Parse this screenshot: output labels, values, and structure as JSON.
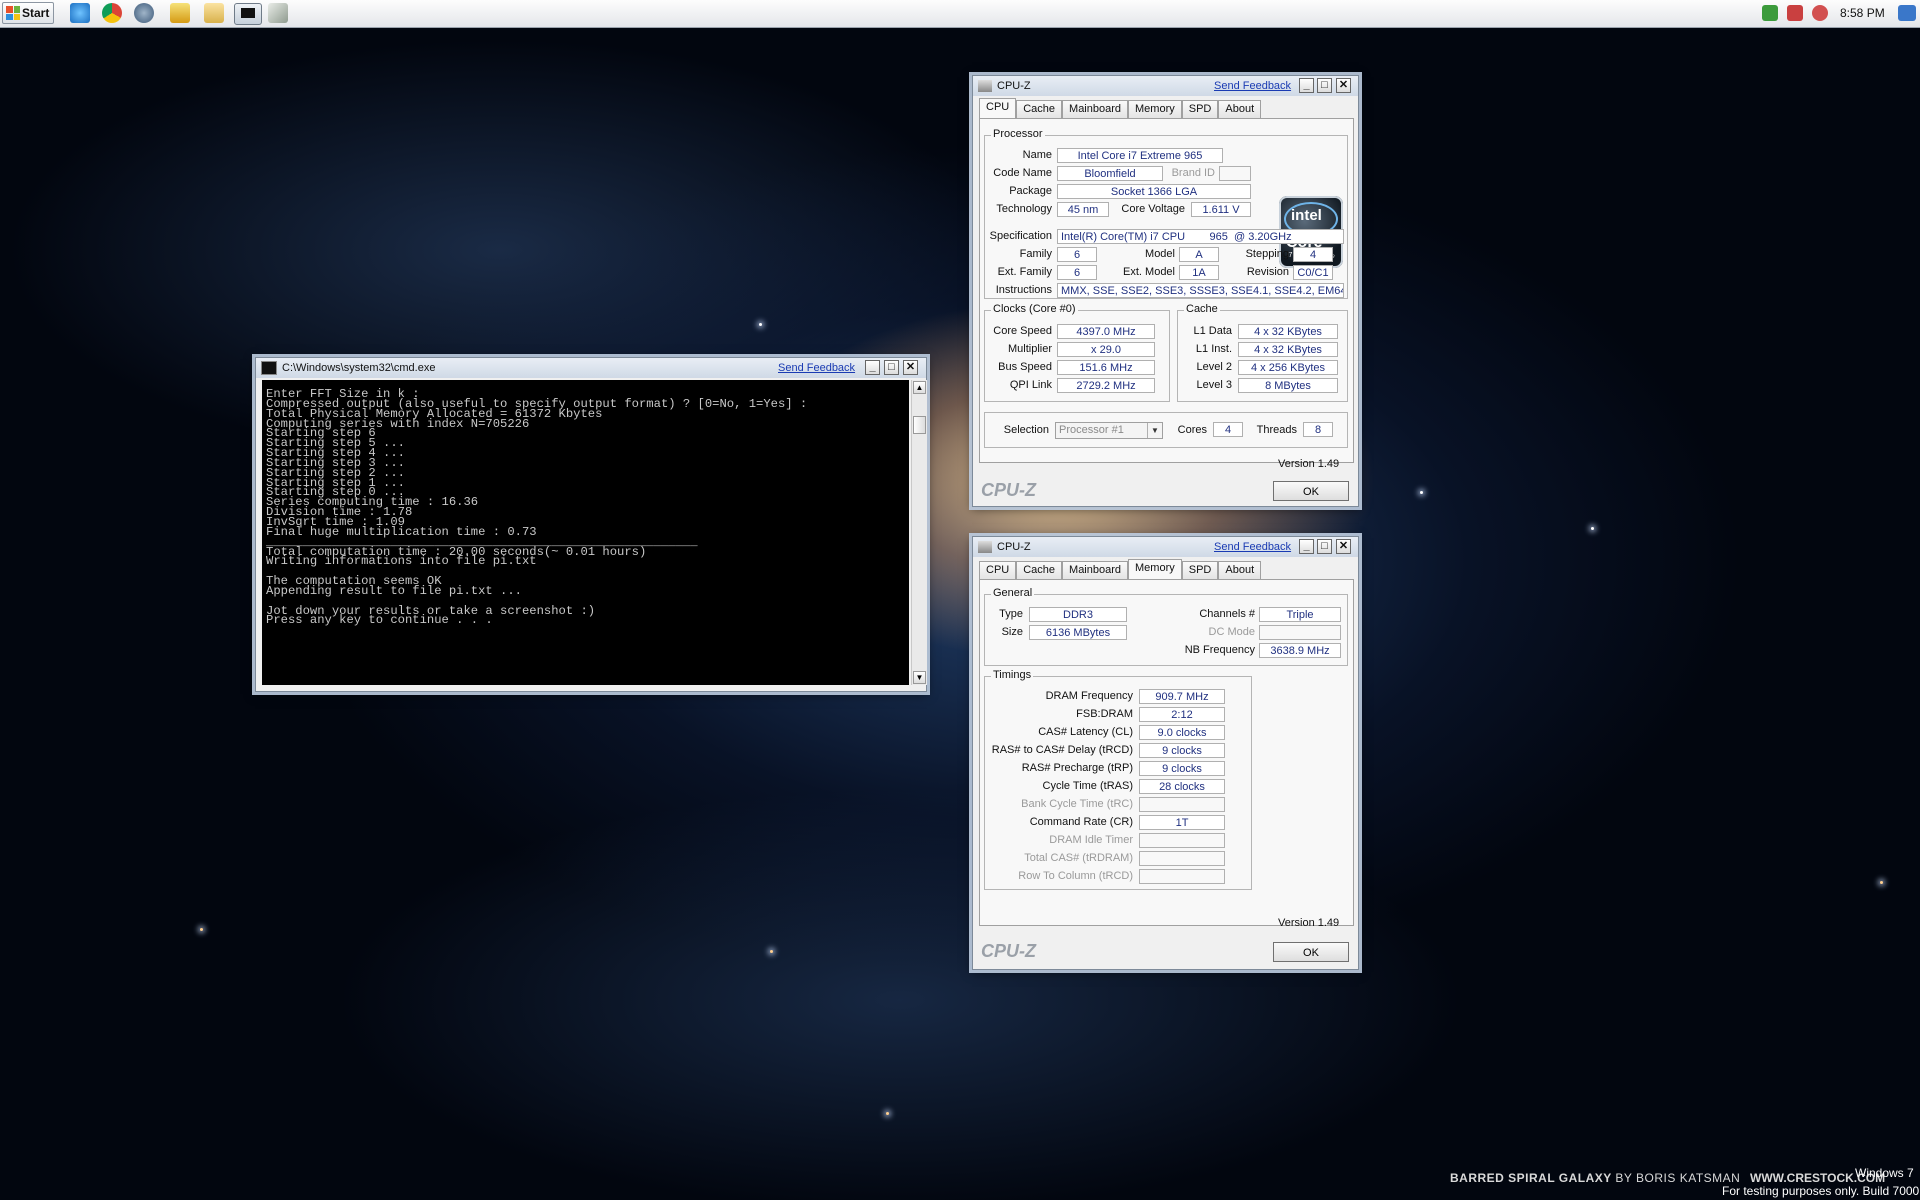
{
  "taskbar": {
    "start_label": "Start",
    "clock": "8:58 PM",
    "quicklaunch": [
      "ie-icon",
      "chrome-icon",
      "network-icon",
      "media-player-icon",
      "folder-icon",
      "cmd-icon",
      "stack-icon"
    ]
  },
  "cmd": {
    "title": "C:\\Windows\\system32\\cmd.exe",
    "feedback": "Send Feedback",
    "lines": [
      "Enter FFT Size in k :",
      "Compressed output (also useful to specify output format) ? [0=No, 1=Yes] :",
      "Total Physical Memory Allocated = 61372 Kbytes",
      "Computing series with index N=705226",
      "Starting step 6",
      "Starting step 5 ...",
      "Starting step 4 ...",
      "Starting step 3 ...",
      "Starting step 2 ...",
      "Starting step 1 ...",
      "Starting step 0 ...",
      "Series computing time : 16.36",
      "Division time : 1.78",
      "InvSqrt time : 1.09",
      "Final huge multiplication time : 0.73",
      "___________________________________________________________",
      "Total computation time : 20.00 seconds(~ 0.01 hours)",
      "Writing informations into file pi.txt",
      "",
      "The computation seems OK",
      "Appending result to file pi.txt ...",
      "",
      "Jot down your results or take a screenshot :)",
      "Press any key to continue . . ."
    ]
  },
  "cpuz1": {
    "title": "CPU-Z",
    "feedback": "Send Feedback",
    "tabs": [
      "CPU",
      "Cache",
      "Mainboard",
      "Memory",
      "SPD",
      "About"
    ],
    "processor": {
      "legend": "Processor",
      "name_label": "Name",
      "name": "Intel Core i7 Extreme 965",
      "codename_label": "Code Name",
      "codename": "Bloomfield",
      "brandid_label": "Brand ID",
      "package_label": "Package",
      "package": "Socket 1366 LGA",
      "tech_label": "Technology",
      "tech": "45 nm",
      "voltage_label": "Core Voltage",
      "voltage": "1.611 V",
      "spec_label": "Specification",
      "spec": "Intel(R) Core(TM) i7 CPU        965  @ 3.20GHz",
      "family_label": "Family",
      "family": "6",
      "model_label": "Model",
      "model": "A",
      "stepping_label": "Stepping",
      "stepping": "4",
      "extfamily_label": "Ext. Family",
      "extfamily": "6",
      "extmodel_label": "Ext. Model",
      "extmodel": "1A",
      "revision_label": "Revision",
      "revision": "C0/C1",
      "instr_label": "Instructions",
      "instr": "MMX, SSE, SSE2, SSE3, SSSE3, SSE4.1, SSE4.2, EM64T",
      "logo": {
        "brand": "intel",
        "line": "Core",
        "badge": "i7",
        "inside": "inside"
      }
    },
    "clocks": {
      "legend": "Clocks (Core #0)",
      "speed_label": "Core Speed",
      "speed": "4397.0 MHz",
      "mult_label": "Multiplier",
      "mult": "x 29.0",
      "bus_label": "Bus Speed",
      "bus": "151.6 MHz",
      "qpi_label": "QPI Link",
      "qpi": "2729.2 MHz"
    },
    "cache": {
      "legend": "Cache",
      "l1d_label": "L1 Data",
      "l1d": "4 x 32 KBytes",
      "l1i_label": "L1 Inst.",
      "l1i": "4 x 32 KBytes",
      "l2_label": "Level 2",
      "l2": "4 x 256 KBytes",
      "l3_label": "Level 3",
      "l3": "8 MBytes"
    },
    "selection_label": "Selection",
    "selection": "Processor #1",
    "cores_label": "Cores",
    "cores": "4",
    "threads_label": "Threads",
    "threads": "8",
    "version": "Version 1.49",
    "brand": "CPU-Z",
    "ok": "OK"
  },
  "cpuz2": {
    "title": "CPU-Z",
    "feedback": "Send Feedback",
    "tabs": [
      "CPU",
      "Cache",
      "Mainboard",
      "Memory",
      "SPD",
      "About"
    ],
    "general": {
      "legend": "General",
      "type_label": "Type",
      "type": "DDR3",
      "size_label": "Size",
      "size": "6136 MBytes",
      "channels_label": "Channels #",
      "channels": "Triple",
      "dcmode_label": "DC Mode",
      "nb_label": "NB Frequency",
      "nb": "3638.9 MHz"
    },
    "timings": {
      "legend": "Timings",
      "rows": [
        {
          "label": "DRAM Frequency",
          "value": "909.7 MHz",
          "dim": false
        },
        {
          "label": "FSB:DRAM",
          "value": "2:12",
          "dim": false
        },
        {
          "label": "CAS# Latency (CL)",
          "value": "9.0 clocks",
          "dim": false
        },
        {
          "label": "RAS# to CAS# Delay (tRCD)",
          "value": "9 clocks",
          "dim": false
        },
        {
          "label": "RAS# Precharge (tRP)",
          "value": "9 clocks",
          "dim": false
        },
        {
          "label": "Cycle Time (tRAS)",
          "value": "28 clocks",
          "dim": false
        },
        {
          "label": "Bank Cycle Time (tRC)",
          "value": "",
          "dim": true
        },
        {
          "label": "Command Rate (CR)",
          "value": "1T",
          "dim": false
        },
        {
          "label": "DRAM Idle Timer",
          "value": "",
          "dim": true
        },
        {
          "label": "Total CAS# (tRDRAM)",
          "value": "",
          "dim": true
        },
        {
          "label": "Row To Column (tRCD)",
          "value": "",
          "dim": true
        }
      ]
    },
    "version": "Version 1.49",
    "brand": "CPU-Z",
    "ok": "OK"
  },
  "desktop": {
    "wallpaper_credit_1": "BARRED SPIRAL GALAXY",
    "wallpaper_credit_2": "BY BORIS KATSMAN",
    "wallpaper_credit_3": "WWW.CRESTOCK.COM",
    "os_line1": "Windows 7",
    "os_line2": "For testing purposes only. Build 7000"
  }
}
